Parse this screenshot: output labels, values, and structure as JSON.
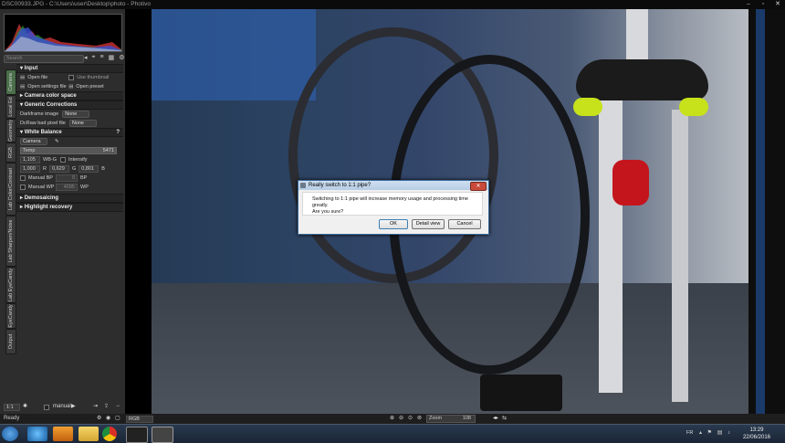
{
  "window": {
    "title": "DSC00933.JPG - C:\\Users\\user\\Desktop\\photo - Photivo"
  },
  "left_panel": {
    "search_placeholder": "Search",
    "vertical_tabs": [
      "Camera",
      "Local Ed",
      "Geometry",
      "RGB",
      "Lab Color/Contrast",
      "Lab Sharpen/Noise",
      "Lab EyeCandy",
      "EyeCandy",
      "Output"
    ],
    "sections": {
      "input": {
        "title": "Input",
        "open_file": "Open file",
        "use_thumbnail": "Use thumbnail",
        "open_settings_file": "Open settings file",
        "open_preset": "Open preset"
      },
      "camera_color_space": {
        "title": "Camera color space"
      },
      "generic_corrections": {
        "title": "Generic Corrections",
        "darkframe_label": "Darkframe image",
        "darkframe_value": "None",
        "badpixel_label": "DcRaw bad pixel file",
        "badpixel_value": "None"
      },
      "white_balance": {
        "title": "White Balance",
        "preset_value": "Camera",
        "temp_label": "Temp",
        "temp_value": "5471",
        "wbg_value": "1,105",
        "wbg_label": "WB-G",
        "intensify_label": "Intensify",
        "r_value": "1,000",
        "r_label": "R",
        "g_value": "0,629",
        "g_label": "G",
        "b_value": "0,801",
        "b_label": "B",
        "manual_bp_label": "Manual BP",
        "bp_value": "0",
        "bp_label": "BP",
        "manual_wp_label": "Manual WP",
        "wp_value": "4095",
        "wp_label": "WP"
      },
      "demosaicing": {
        "title": "Demosaicing"
      },
      "highlight_recovery": {
        "title": "Highlight recovery"
      }
    },
    "bottom": {
      "pipe_value": "1:1",
      "mode_value": "manual"
    }
  },
  "status": {
    "ready": "Ready",
    "color_space": "RGB",
    "zoom_label": "Zoom",
    "zoom_value": "108"
  },
  "dialog": {
    "title": "Really switch to 1:1 pipe?",
    "message_line1": "Switching to 1:1 pipe will increase memory usage and processing time greatly.",
    "message_line2": "Are you sure?",
    "ok": "OK",
    "detail": "Detail view",
    "cancel": "Cancel"
  },
  "taskbar": {
    "lang": "FR",
    "time": "13:29",
    "date": "22/06/2016"
  }
}
